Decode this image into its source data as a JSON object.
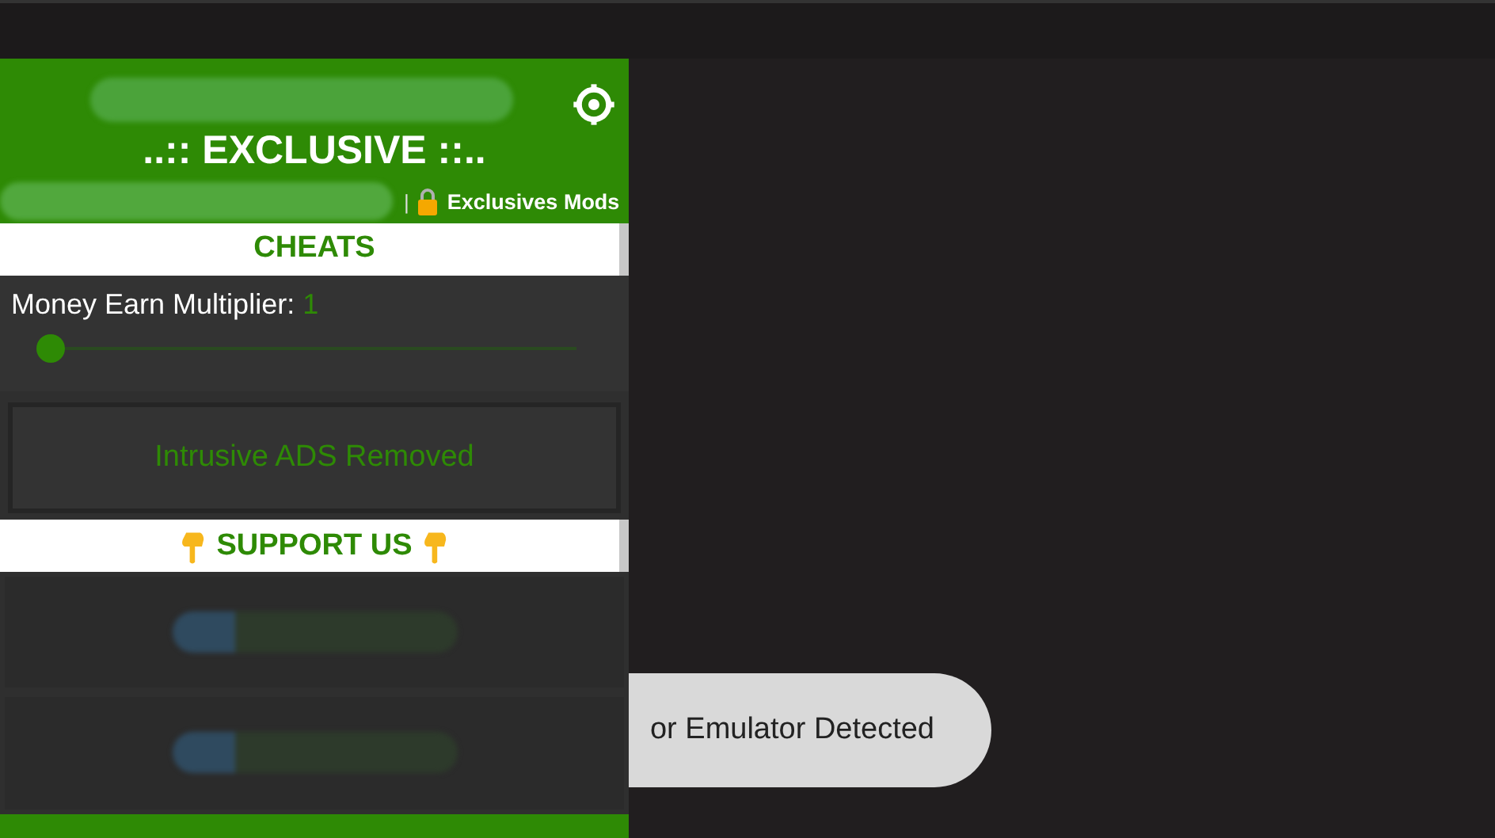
{
  "header": {
    "title": "..:: EXCLUSIVE ::..",
    "subtitle": "Exclusives Mods",
    "separator": "|"
  },
  "sections": [
    {
      "kind": "heading",
      "text": "CHEATS"
    },
    {
      "kind": "slider",
      "label": "Money Earn Multiplier:",
      "value": "1",
      "level": 0
    },
    {
      "kind": "notice",
      "text": "Intrusive ADS Removed"
    },
    {
      "kind": "heading",
      "text": "SUPPORT US",
      "icons": true
    },
    {
      "kind": "blurred"
    },
    {
      "kind": "blurred"
    }
  ],
  "toast": {
    "text": "or Emulator Detected"
  }
}
